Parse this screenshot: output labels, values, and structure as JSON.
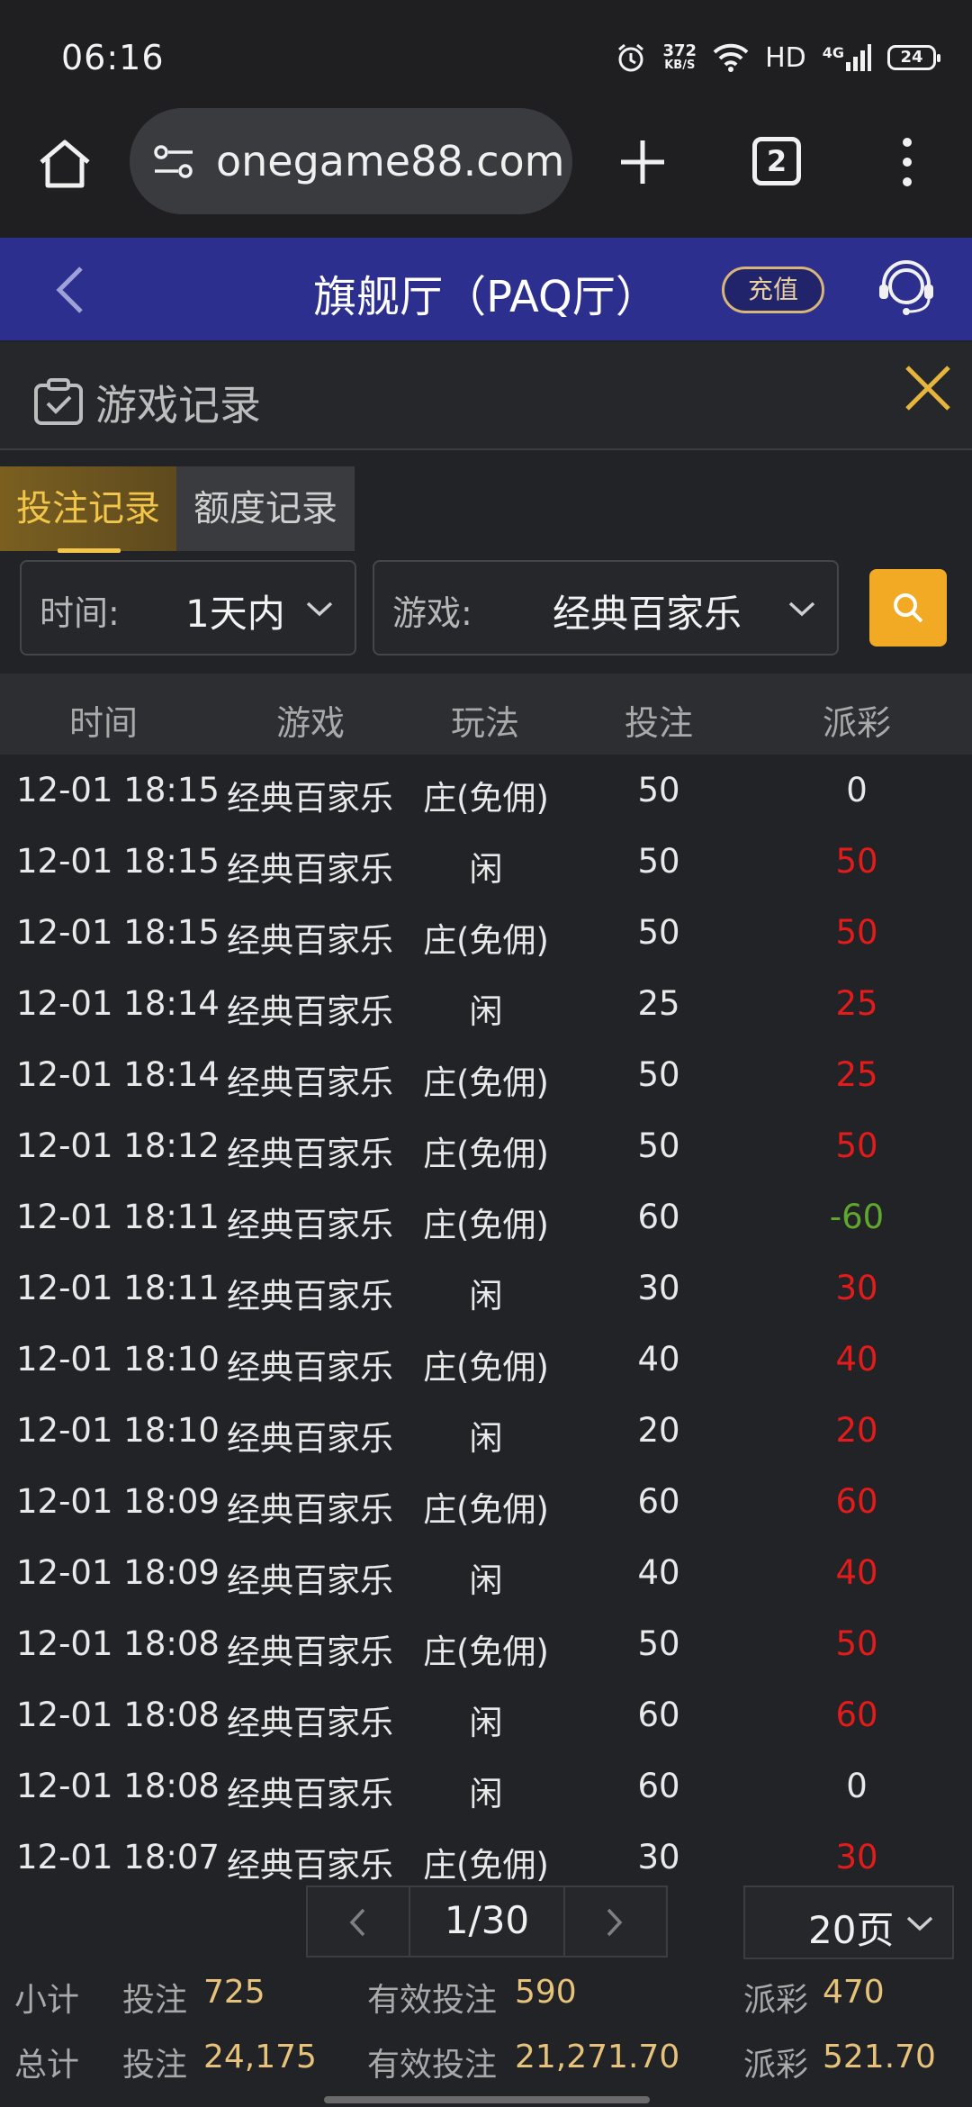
{
  "status_bar": {
    "time": "06:16",
    "net_speed_value": "372",
    "net_speed_unit": "KB/S",
    "hd": "HD",
    "network": "4G",
    "battery": "24"
  },
  "browser": {
    "url": "onegame88.com/",
    "tab_count": "2"
  },
  "header": {
    "title": "旗舰厅（PAQ厅）",
    "recharge_label": "充值"
  },
  "panel": {
    "title": "游戏记录"
  },
  "tabs": [
    {
      "label": "投注记录",
      "active": true
    },
    {
      "label": "额度记录",
      "active": false
    }
  ],
  "filters": {
    "time_label": "时间:",
    "time_value": "1天内",
    "game_label": "游戏:",
    "game_value": "经典百家乐"
  },
  "table": {
    "columns": [
      "时间",
      "游戏",
      "玩法",
      "投注",
      "派彩"
    ],
    "rows": [
      {
        "time": "12-01 18:15",
        "game": "经典百家乐",
        "play": "庄(免佣)",
        "bet": "50",
        "payout": "0",
        "tone": "white"
      },
      {
        "time": "12-01 18:15",
        "game": "经典百家乐",
        "play": "闲",
        "bet": "50",
        "payout": "50",
        "tone": "red"
      },
      {
        "time": "12-01 18:15",
        "game": "经典百家乐",
        "play": "庄(免佣)",
        "bet": "50",
        "payout": "50",
        "tone": "red"
      },
      {
        "time": "12-01 18:14",
        "game": "经典百家乐",
        "play": "闲",
        "bet": "25",
        "payout": "25",
        "tone": "red"
      },
      {
        "time": "12-01 18:14",
        "game": "经典百家乐",
        "play": "庄(免佣)",
        "bet": "50",
        "payout": "25",
        "tone": "red"
      },
      {
        "time": "12-01 18:12",
        "game": "经典百家乐",
        "play": "庄(免佣)",
        "bet": "50",
        "payout": "50",
        "tone": "red"
      },
      {
        "time": "12-01 18:11",
        "game": "经典百家乐",
        "play": "庄(免佣)",
        "bet": "60",
        "payout": "-60",
        "tone": "green"
      },
      {
        "time": "12-01 18:11",
        "game": "经典百家乐",
        "play": "闲",
        "bet": "30",
        "payout": "30",
        "tone": "red"
      },
      {
        "time": "12-01 18:10",
        "game": "经典百家乐",
        "play": "庄(免佣)",
        "bet": "40",
        "payout": "40",
        "tone": "red"
      },
      {
        "time": "12-01 18:10",
        "game": "经典百家乐",
        "play": "闲",
        "bet": "20",
        "payout": "20",
        "tone": "red"
      },
      {
        "time": "12-01 18:09",
        "game": "经典百家乐",
        "play": "庄(免佣)",
        "bet": "60",
        "payout": "60",
        "tone": "red"
      },
      {
        "time": "12-01 18:09",
        "game": "经典百家乐",
        "play": "闲",
        "bet": "40",
        "payout": "40",
        "tone": "red"
      },
      {
        "time": "12-01 18:08",
        "game": "经典百家乐",
        "play": "庄(免佣)",
        "bet": "50",
        "payout": "50",
        "tone": "red"
      },
      {
        "time": "12-01 18:08",
        "game": "经典百家乐",
        "play": "闲",
        "bet": "60",
        "payout": "60",
        "tone": "red"
      },
      {
        "time": "12-01 18:08",
        "game": "经典百家乐",
        "play": "闲",
        "bet": "60",
        "payout": "0",
        "tone": "white"
      },
      {
        "time": "12-01 18:07",
        "game": "经典百家乐",
        "play": "庄(免佣)",
        "bet": "30",
        "payout": "30",
        "tone": "red"
      }
    ]
  },
  "pagination": {
    "page_indicator": "1/30",
    "page_size": "20页"
  },
  "summary": {
    "subtotal_label": "小计",
    "subtotal_bet_label": "投注",
    "subtotal_bet": "725",
    "subtotal_valid_label": "有效投注",
    "subtotal_valid": "590",
    "subtotal_payout_label": "派彩",
    "subtotal_payout": "470",
    "total_label": "总计",
    "total_bet_label": "投注",
    "total_bet": "24,175",
    "total_valid_label": "有效投注",
    "total_valid": "21,271.70",
    "total_payout_label": "派彩",
    "total_payout": "521.70"
  },
  "colors": {
    "header_bg": "#2d2f8e",
    "accent_gold": "#f2c64a",
    "search_orange": "#f2aa24",
    "payout_red": "#e31b1b",
    "payout_green": "#5fa72d"
  }
}
